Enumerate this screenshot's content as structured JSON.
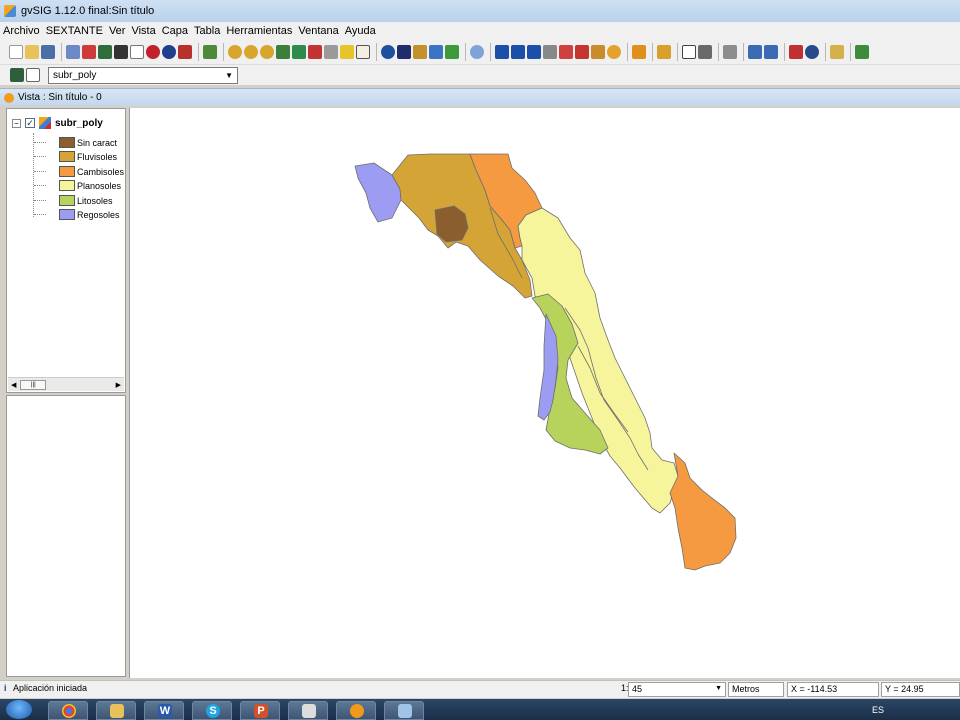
{
  "window": {
    "title": "gvSIG 1.12.0 final:Sin título"
  },
  "menu": [
    "Archivo",
    "SEXTANTE",
    "Ver",
    "Vista",
    "Capa",
    "Tabla",
    "Herramientas",
    "Ventana",
    "Ayuda"
  ],
  "toolbar2": {
    "layer_selected": "subr_poly"
  },
  "view": {
    "title": "Vista : Sin título - 0"
  },
  "toc": {
    "layer_name": "subr_poly",
    "checked": true,
    "legend": [
      {
        "label": "Sin caract",
        "color": "#8b5e2e"
      },
      {
        "label": "Fluvisoles",
        "color": "#d4a437"
      },
      {
        "label": "Cambisoles",
        "color": "#f59a40"
      },
      {
        "label": "Planosoles",
        "color": "#f6f59c"
      },
      {
        "label": "Litosoles",
        "color": "#b7d35c"
      },
      {
        "label": "Regosoles",
        "color": "#9c9cf2"
      }
    ]
  },
  "status": {
    "message": "Aplicación iniciada",
    "scale_label": "1:",
    "scale_value": "45",
    "units": "Metros",
    "x": "X = -114.53",
    "y": "Y = 24.95"
  },
  "taskbar": {
    "lang": "ES"
  }
}
